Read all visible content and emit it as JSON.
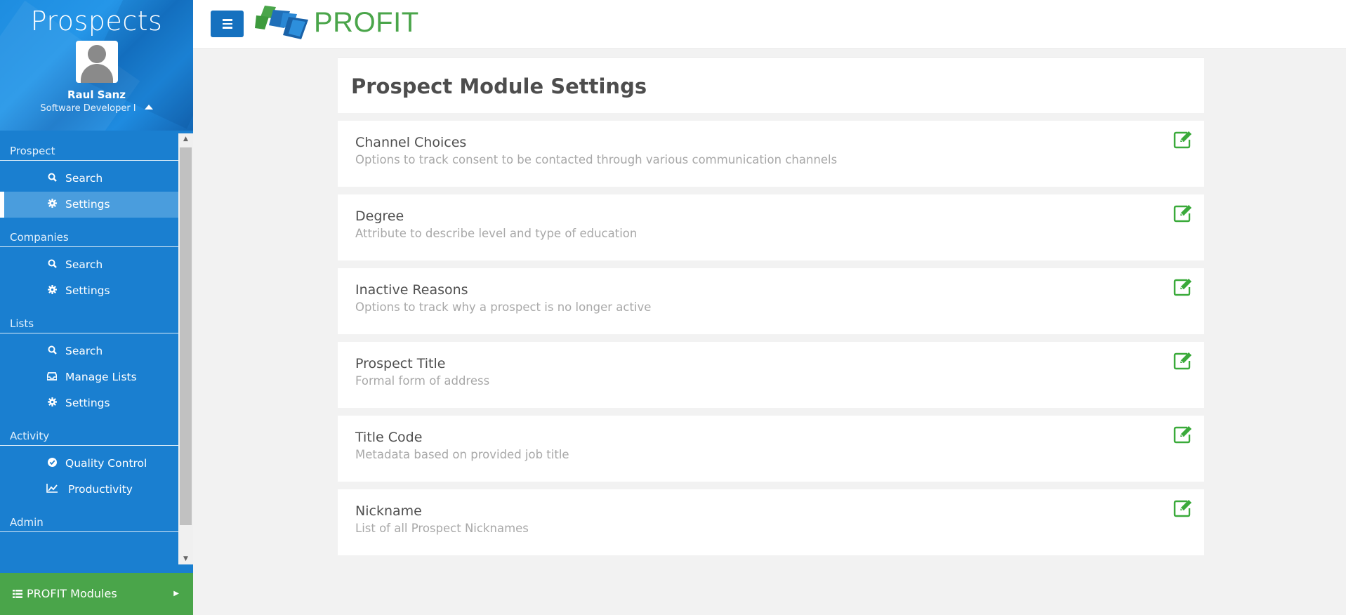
{
  "sidebar": {
    "app_title": "Prospects",
    "user_name": "Raul Sanz",
    "user_role": "Software Developer I",
    "sections": [
      {
        "label": "Prospect",
        "items": [
          {
            "label": "Search",
            "icon": "search-icon"
          },
          {
            "label": "Settings",
            "icon": "gear-icon",
            "active": true
          }
        ]
      },
      {
        "label": "Companies",
        "items": [
          {
            "label": "Search",
            "icon": "search-icon"
          },
          {
            "label": "Settings",
            "icon": "gear-icon"
          }
        ]
      },
      {
        "label": "Lists",
        "items": [
          {
            "label": "Search",
            "icon": "search-icon"
          },
          {
            "label": "Manage Lists",
            "icon": "inbox-icon"
          },
          {
            "label": "Settings",
            "icon": "gear-icon"
          }
        ]
      },
      {
        "label": "Activity",
        "items": [
          {
            "label": "Quality Control",
            "icon": "check-circle-icon"
          },
          {
            "label": "Productivity",
            "icon": "line-chart-icon"
          }
        ]
      },
      {
        "label": "Admin",
        "items": []
      }
    ],
    "modules_label": "PROFIT Modules"
  },
  "header": {
    "logo_text": "PROFIT",
    "brand_color": "#4aa54a",
    "accent_color": "#1571bf"
  },
  "main": {
    "title": "Prospect Module Settings",
    "cards": [
      {
        "title": "Channel Choices",
        "description": "Options to track consent to be contacted through various communication channels"
      },
      {
        "title": "Degree",
        "description": "Attribute to describe level and type of education"
      },
      {
        "title": "Inactive Reasons",
        "description": "Options to track why a prospect is no longer active"
      },
      {
        "title": "Prospect Title",
        "description": "Formal form of address"
      },
      {
        "title": "Title Code",
        "description": "Metadata based on provided job title"
      },
      {
        "title": "Nickname",
        "description": "List of all Prospect Nicknames"
      }
    ]
  }
}
